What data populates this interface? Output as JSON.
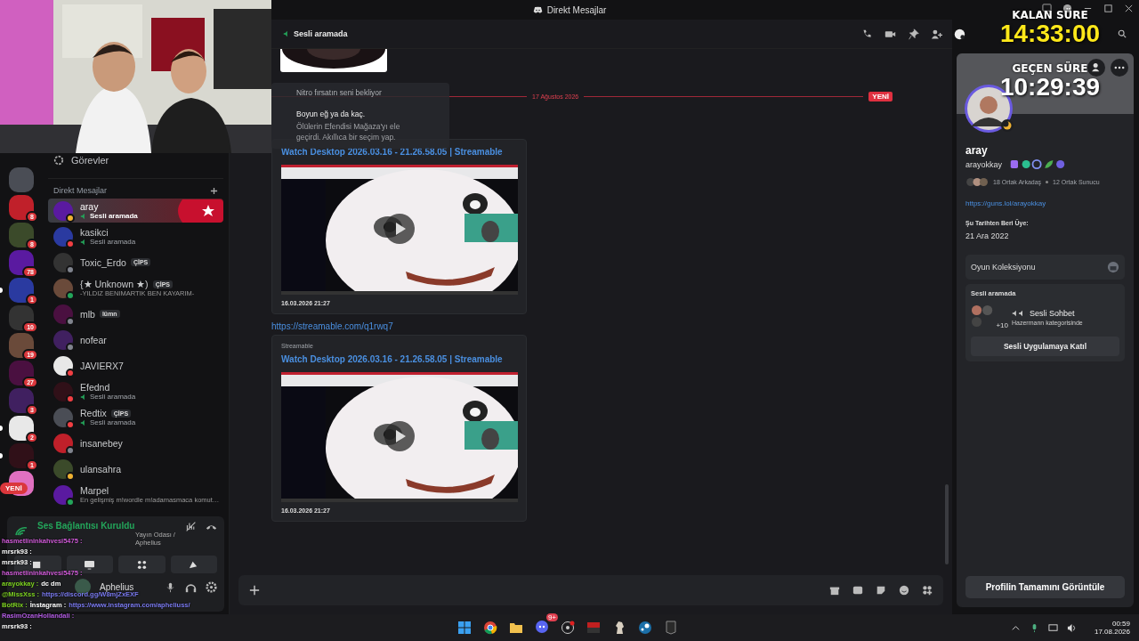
{
  "window": {
    "title": "Direkt Mesajlar"
  },
  "timer": {
    "remaining_label": "KALAN SÜRE",
    "remaining": "14:33:00",
    "elapsed_label": "GEÇEN SÜRE",
    "elapsed": "10:29:39"
  },
  "servers": [
    {
      "unread": false
    },
    {
      "badge": "8",
      "unread": false
    },
    {
      "badge": "8",
      "unread": false
    },
    {
      "badge": "78",
      "unread": false
    },
    {
      "badge": "1",
      "unread": true
    },
    {
      "badge": "10",
      "unread": false
    },
    {
      "badge": "19",
      "unread": false
    },
    {
      "badge": "27",
      "unread": false
    },
    {
      "badge": "3",
      "unread": false
    },
    {
      "badge": "2",
      "unread": true
    },
    {
      "badge": "1",
      "unread": true
    }
  ],
  "new_pill": "YENİ",
  "sidebar": {
    "quests": "Görevler",
    "dm_heading": "Direkt Mesajlar",
    "items": [
      {
        "name": "aray",
        "activity": "Sesli aramada",
        "color": "#f0b232",
        "selected": true
      },
      {
        "name": "kasikci",
        "activity": "Sesli aramada",
        "color": "#f23f43",
        "selected": false
      },
      {
        "name": "Toxic_Erdo",
        "tag": "ÇİPS",
        "color": "#80848e",
        "selected": false
      },
      {
        "name": "{★ Unknown ★)",
        "tag": "ÇİPS",
        "subtitle": "-YILDIZ BENIMARTIK BEN KAYARIM-",
        "color": "#23a55a",
        "selected": false
      },
      {
        "name": "mlb",
        "tag": "lümn",
        "color": "#80848e",
        "selected": false
      },
      {
        "name": "nofear",
        "color": "#80848e",
        "selected": false
      },
      {
        "name": "JAVIERX7",
        "color": "#f23f43",
        "selected": false
      },
      {
        "name": "Efednd",
        "activity": "Sesli aramada",
        "color": "#f23f43",
        "selected": false
      },
      {
        "name": "Redtix",
        "activity": "Sesli aramada",
        "tag": "ÇİPS",
        "color": "#f23f43",
        "selected": false
      },
      {
        "name": "insanebey",
        "color": "#80848e",
        "selected": false
      },
      {
        "name": "ulansahra",
        "color": "#f0b232",
        "selected": false
      },
      {
        "name": "Marpel",
        "subtitle": "En gelişmiş m!wordle m!adamasmaca komut…",
        "color": "#23a55a",
        "selected": false
      }
    ]
  },
  "voice_panel": {
    "status": "Ses Bağlantısı Kuruldu",
    "channel": "Yayın Odası / Aphelius",
    "user": "Aphelius"
  },
  "stream_chat": [
    {
      "user": "hasmetlininkahvesi5475 :",
      "color": "#d05ad8"
    },
    {
      "user": "mrsrk93 :",
      "color": "#ffffff"
    },
    {
      "user": "mrsrk93 :",
      "color": "#ffffff"
    },
    {
      "user": "hasmetlininkahvesi5475 :",
      "color": "#d05ad8"
    },
    {
      "user": "arayokkay :",
      "color": "#7ed321",
      "text": "dc dm"
    },
    {
      "user": "@MissXss :",
      "color": "#7ed321",
      "link": "https://discord.gg/W8mjZxEXF"
    },
    {
      "user": "BotRix :",
      "color": "#7ed321",
      "text": "İnstagram :",
      "link": "https://www.instagram.com/apheliuss/"
    },
    {
      "user": "RasimOzanHollandali :",
      "color": "#b05ae0"
    },
    {
      "user": "mrsrk93 :",
      "color": "#ffffff"
    }
  ],
  "chat": {
    "header_status": "Sesli aramada",
    "divider_date": "17 Ağustos 2026",
    "divider_badge": "YENİ",
    "popup": {
      "title": "Nitro fırsatın seni bekliyor",
      "heading": "Boyun eğ ya da kaç.",
      "body": "Ölülerin Efendisi Mağaza'yı ele geçirdi. Akıllıca bir seçim yap."
    },
    "link": "https://streamable.com/q1rwq7",
    "embeds": [
      {
        "title": "Watch Desktop 2026.03.16 - 21.26.58.05 | Streamable",
        "date": "16.03.2026 21:27"
      },
      {
        "provider": "Streamable",
        "title": "Watch Desktop 2026.03.16 - 21.26.58.05 | Streamable",
        "date": "16.03.2026 21:27"
      }
    ]
  },
  "profile": {
    "name": "aray",
    "username": "arayokkay",
    "mutual_friends": "18 Ortak Arkadaş",
    "mutual_servers": "12 Ortak Sunucu",
    "link": "https://guns.lol/arayokkay",
    "member_since_label": "Şu Tarihten Beri Üye:",
    "member_since": "21 Ara 2022",
    "collection": "Oyun Koleksiyonu",
    "voice_heading": "Sesli aramada",
    "voice_extra": "+10",
    "voice_channel": "Sesli Sohbet",
    "voice_category": "Hazermann kategorisinde",
    "join_button": "Sesli Uygulamaya Katıl",
    "full_profile_button": "Profilin Tamamını Görüntüle"
  },
  "taskbar": {
    "discord_badge": "9+",
    "time": "00:59",
    "date": "17.08.2026"
  }
}
